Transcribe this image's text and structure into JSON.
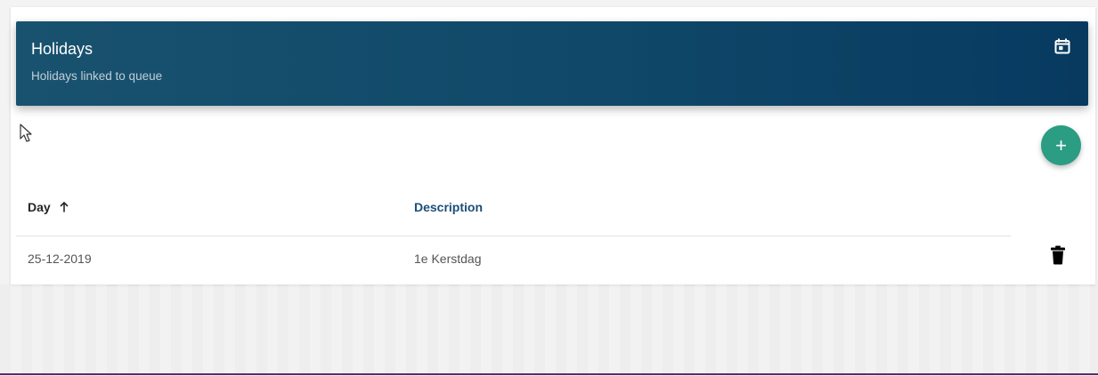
{
  "header": {
    "title": "Holidays",
    "subtitle": "Holidays linked to queue",
    "icon": "calendar-icon"
  },
  "actions": {
    "add_label": "+",
    "add_icon": "plus-icon",
    "delete_icon": "delete-icon"
  },
  "table": {
    "columns": {
      "day": "Day",
      "description": "Description"
    },
    "sort_icon": "sort-up-icon",
    "rows": [
      {
        "day": "25-12-2019",
        "description": "1e Kerstdag"
      }
    ]
  },
  "colors": {
    "header_background": "#0f4869",
    "add_button": "#2a9d83",
    "description_header": "#1b4e76"
  }
}
